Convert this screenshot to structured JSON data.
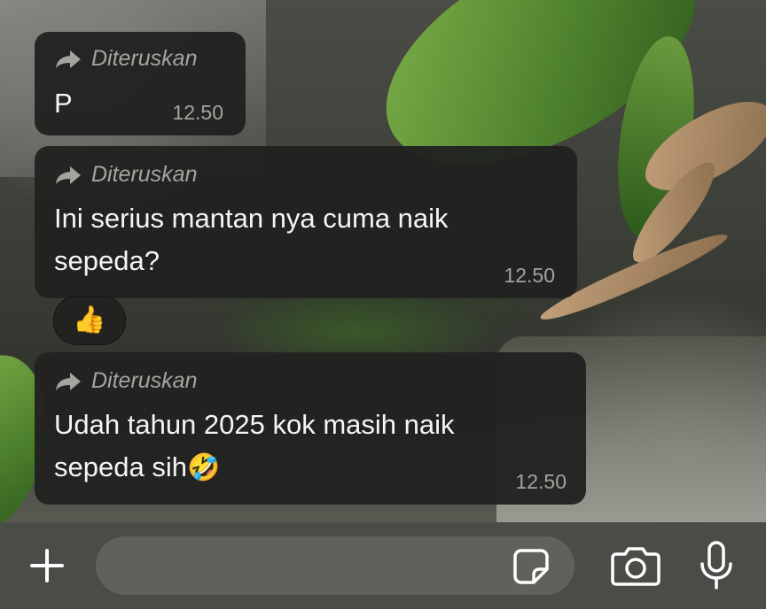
{
  "chat": {
    "messages": [
      {
        "forwarded_label": "Diteruskan",
        "text": "P",
        "time": "12.50"
      },
      {
        "forwarded_label": "Diteruskan",
        "text": "Ini serius mantan nya cuma naik sepeda?",
        "time": "12.50",
        "reaction": "👍"
      },
      {
        "forwarded_label": "Diteruskan",
        "text": "Udah tahun 2025 kok masih naik sepeda sih",
        "emoji": "🤣",
        "time": "12.50"
      }
    ]
  },
  "input_bar": {
    "message_placeholder": "",
    "icons": {
      "attach": "plus-icon",
      "sticker": "sticker-icon",
      "camera": "camera-icon",
      "voice": "microphone-icon"
    }
  },
  "colors": {
    "bubble_bg": "#212220",
    "bubble_text": "#f5f5f3",
    "meta_text": "#a3a4a0",
    "input_bar_bg": "#4a4c47",
    "input_field_bg": "#5f615b"
  }
}
